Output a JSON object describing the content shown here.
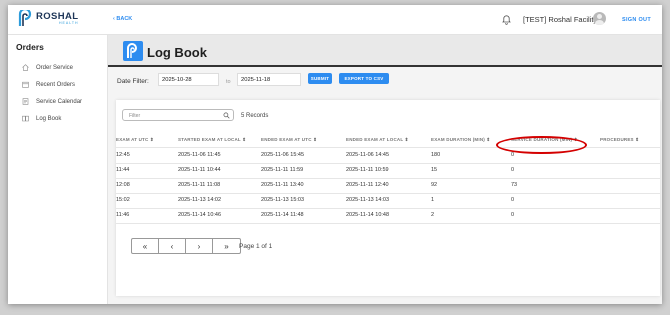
{
  "brand": {
    "name": "ROSHAL",
    "sub": "HEALTH"
  },
  "topbar": {
    "back_label": "BACK",
    "facility": "[TEST] Roshal Facility",
    "signout_label": "SIGN OUT"
  },
  "sidebar": {
    "title": "Orders",
    "items": [
      {
        "label": "Order Service",
        "icon": "home-icon"
      },
      {
        "label": "Recent Orders",
        "icon": "calendar-icon"
      },
      {
        "label": "Service Calendar",
        "icon": "document-icon"
      },
      {
        "label": "Log Book",
        "icon": "book-icon"
      }
    ]
  },
  "page": {
    "title": "Log Book"
  },
  "filters": {
    "date_label": "Date Filter:",
    "from": "2025-10-28",
    "to_label": "to",
    "to": "2025-11-18",
    "submit_label": "SUBMIT",
    "export_label": "EXPORT TO CSV"
  },
  "table": {
    "filter_placeholder": "Filter",
    "records": "5 Records",
    "headers": [
      "EXAM AT UTC",
      "STARTED EXAM AT LOCAL",
      "ENDED EXAM AT UTC",
      "ENDED EXAM AT LOCAL",
      "EXAM DURATION (MIN)",
      "SERVICE DURATION (MIN)",
      "PROCEDURES"
    ],
    "rows": [
      [
        "12:45",
        "2025-11-06 11:45",
        "2025-11-06 15:45",
        "2025-11-06 14:45",
        "180",
        "0",
        ""
      ],
      [
        "11:44",
        "2025-11-11 10:44",
        "2025-11-11 11:59",
        "2025-11-11 10:59",
        "15",
        "0",
        ""
      ],
      [
        "12:08",
        "2025-11-11 11:08",
        "2025-11-11 13:40",
        "2025-11-11 12:40",
        "92",
        "73",
        ""
      ],
      [
        "15:02",
        "2025-11-13 14:02",
        "2025-11-13 15:03",
        "2025-11-13 14:03",
        "1",
        "0",
        ""
      ],
      [
        "11:46",
        "2025-11-14 10:46",
        "2025-11-14 11:48",
        "2025-11-14 10:48",
        "2",
        "0",
        ""
      ]
    ],
    "page_info": "Page 1 of 1"
  },
  "pagination": {
    "first": "«",
    "prev": "‹",
    "next": "›",
    "last": "»"
  },
  "colors": {
    "accent": "#2d8cf0",
    "annotation": "#d40000"
  }
}
